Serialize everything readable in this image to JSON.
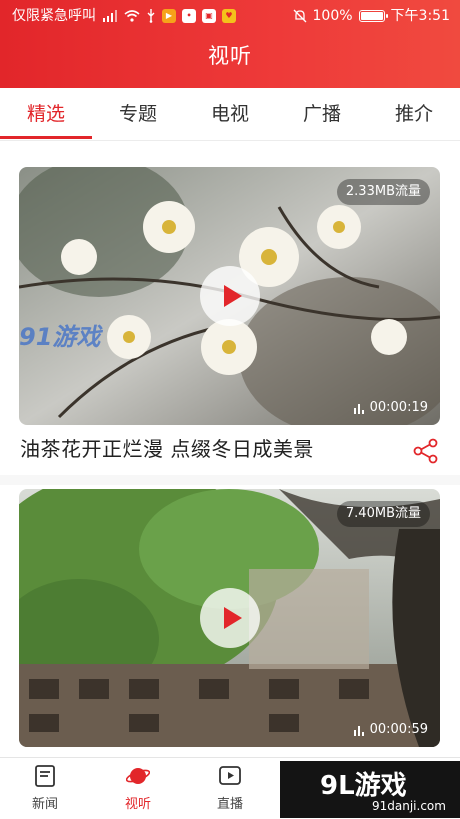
{
  "status_bar": {
    "carrier": "仅限紧急呼叫",
    "battery": "100%",
    "time": "下午3:51"
  },
  "header": {
    "title": "视听"
  },
  "tabs": [
    {
      "label": "精选",
      "active": true
    },
    {
      "label": "专题",
      "active": false
    },
    {
      "label": "电视",
      "active": false
    },
    {
      "label": "广播",
      "active": false
    },
    {
      "label": "推介",
      "active": false
    }
  ],
  "videos": [
    {
      "title": "油茶花开正烂漫   点缀冬日成美景",
      "data_usage": "2.33MB流量",
      "duration": "00:00:19"
    },
    {
      "title": "",
      "data_usage": "7.40MB流量",
      "duration": "00:00:59"
    }
  ],
  "thumb_watermark": "91游戏",
  "bottom_nav": [
    {
      "label": "新闻",
      "icon": "news-icon",
      "active": false
    },
    {
      "label": "视听",
      "icon": "planet-icon",
      "active": true
    },
    {
      "label": "直播",
      "icon": "live-icon",
      "active": false
    }
  ],
  "site_watermark": {
    "brand": "9L游戏",
    "url": "91danji.com"
  },
  "colors": {
    "accent": "#e2262a"
  }
}
